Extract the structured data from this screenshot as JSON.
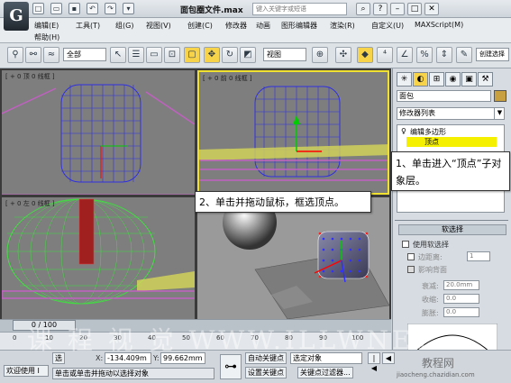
{
  "titlebar": {
    "title": "面包圈文件.max",
    "search_placeholder": "键入关键字或短语",
    "window_buttons": [
      "?",
      "–",
      "□",
      "✕"
    ]
  },
  "menu": {
    "row1": [
      "编辑(E)",
      "工具(T)",
      "组(G)",
      "视图(V)",
      "创建(C)",
      "修改器",
      "动画",
      "图形编辑器",
      "渲染(R)",
      "自定义(U)",
      "MAXScript(M)"
    ],
    "row2": [
      "帮助(H)"
    ]
  },
  "toolbar": {
    "filter_select": "全部",
    "view_select": "视图",
    "right_label": "创建选择"
  },
  "viewports": {
    "top_left_label": "[ + 0 顶 0 线框 ]",
    "top_right_label": "[ + 0 前 0 线框 ]",
    "bottom_left_label": "[ + 0 左 0 线框 ]",
    "bottom_right_label": ""
  },
  "panel": {
    "object_name": "面包",
    "modifier_list": "修改器列表",
    "stack_items": [
      "编辑多边形",
      "顶点"
    ],
    "rollout_title": "软选择",
    "use_soft_selection": "使用软选择",
    "edge_distance": "边距离:",
    "edge_distance_value": "1",
    "affect_backfacing": "影响背面",
    "falloff_label": "衰减:",
    "falloff_value": "20.0mm",
    "pinch_label": "收缩:",
    "pinch_value": "0.0",
    "bubble_label": "膨胀:",
    "bubble_value": "0.0"
  },
  "timeline": {
    "slider": "0 / 100",
    "ticks": [
      "0",
      "10",
      "20",
      "30",
      "40",
      "50",
      "60",
      "70",
      "80",
      "90",
      "100"
    ]
  },
  "status": {
    "welcome": "欢迎使用 I",
    "prompt": "单击或单击并拖动以选择对象",
    "selection_lock": "选",
    "x_label": "X:",
    "x_value": "-134.409m",
    "y_label": "Y:",
    "y_value": "99.662mm",
    "autokey": "自动关键点",
    "selected_set": "选定对象",
    "setkey": "设置关键点",
    "key_filters": "关键点过滤器..."
  },
  "callouts": {
    "step1": "1、单击进入“顶点”子对象层。",
    "step2": "2、单击并拖动鼠标，框选顶点。"
  },
  "watermarks": {
    "tutorial": "课 程 视 觉  WWW.ILLWNET",
    "site": "教程网",
    "url": "jiaocheng.chazidian.com"
  }
}
